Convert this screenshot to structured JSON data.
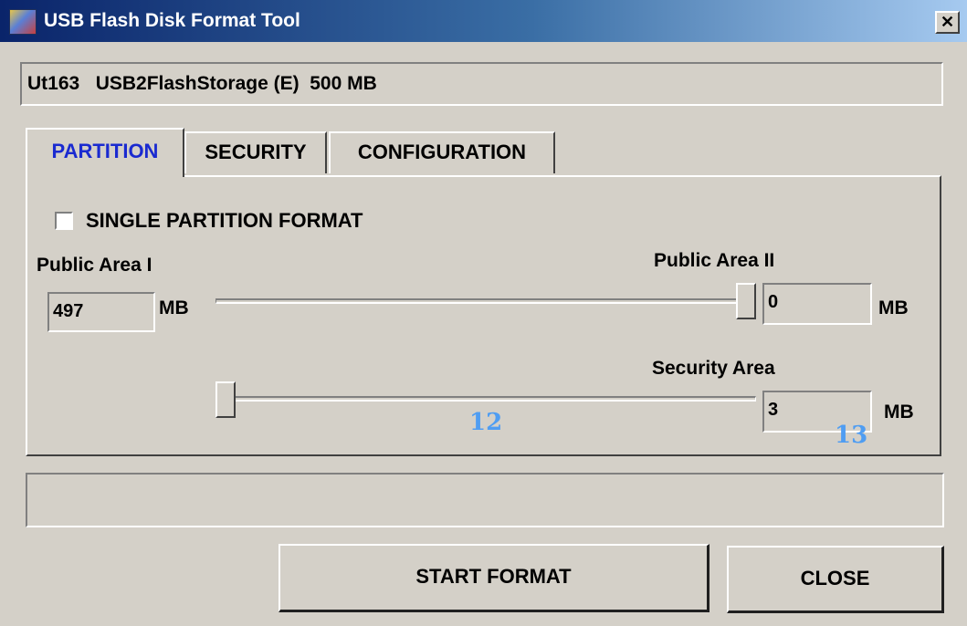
{
  "window": {
    "title": "USB Flash Disk Format Tool",
    "close_glyph": "✕"
  },
  "device": {
    "text": "Ut163   USB2FlashStorage (E)  500 MB"
  },
  "tabs": [
    {
      "label": "PARTITION",
      "active": true
    },
    {
      "label": "SECURITY",
      "active": false
    },
    {
      "label": "CONFIGURATION",
      "active": false
    }
  ],
  "partition": {
    "single_partition_label": "SINGLE PARTITION FORMAT",
    "single_partition_checked": false,
    "public_area_1": {
      "label": "Public Area I",
      "value": "497",
      "unit": "MB"
    },
    "public_area_2": {
      "label": "Public Area II",
      "value": "0",
      "unit": "MB",
      "slider_fraction": 1.0
    },
    "security_area": {
      "label": "Security Area",
      "value": "3",
      "unit": "MB",
      "slider_fraction": 0.0
    }
  },
  "annotations": [
    "12",
    "13"
  ],
  "status": {
    "text": ""
  },
  "buttons": {
    "start_format": "START FORMAT",
    "close": "CLOSE"
  },
  "colors": {
    "active_tab": "#1a2ad0",
    "annotation": "#4f9df2",
    "titlebar_start": "#0a246a"
  }
}
